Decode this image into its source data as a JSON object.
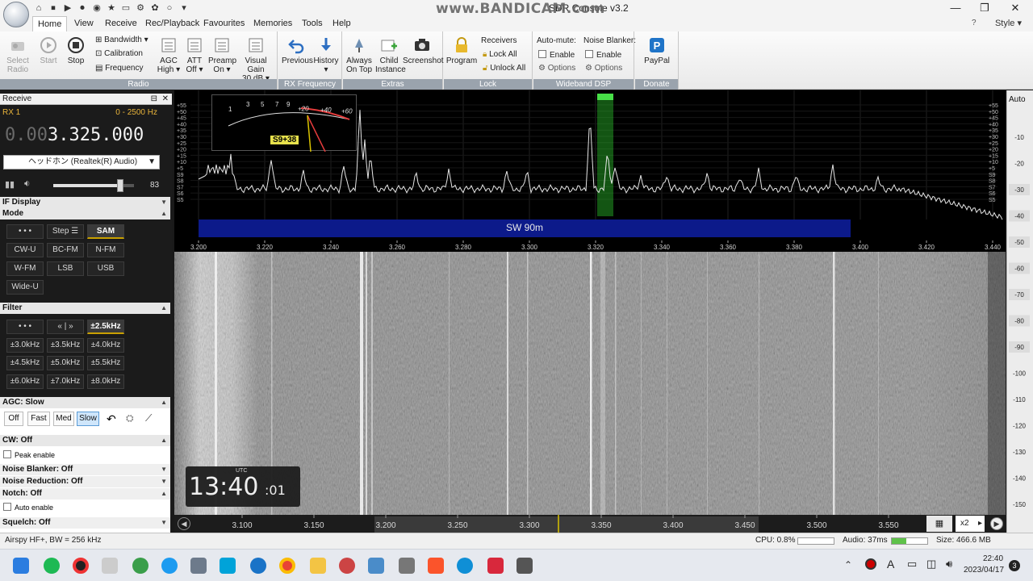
{
  "window": {
    "title": "SDR Console v3.2",
    "watermark": "www.BANDICAM.com",
    "style_label": "Style",
    "minimize": "—",
    "maximize": "❐",
    "close": "✕"
  },
  "menu": {
    "tabs": [
      "Home",
      "View",
      "Receive",
      "Rec/Playback",
      "Favourites",
      "Memories",
      "Tools",
      "Help"
    ]
  },
  "ribbon": {
    "radio": {
      "label": "Radio",
      "select_radio": "Select\nRadio",
      "start": "Start",
      "stop": "Stop",
      "bandwidth": "Bandwidth",
      "calibration": "Calibration",
      "frequency": "Frequency",
      "agc": "AGC",
      "agc_value": "High",
      "att": "ATT",
      "att_value": "Off",
      "preamp": "Preamp",
      "preamp_value": "On",
      "visual_gain": "Visual Gain",
      "visual_gain_value": "30 dB"
    },
    "rx_frequency": {
      "label": "RX Frequency",
      "previous": "Previous",
      "history": "History"
    },
    "extras": {
      "label": "Extras",
      "always_on_top_1": "Always",
      "always_on_top_2": "On Top",
      "child_1": "Child",
      "child_2": "Instance",
      "screenshot": "Screenshot"
    },
    "lock": {
      "label": "Lock",
      "program": "Program",
      "receivers": "Receivers",
      "lock_all": "Lock All",
      "unlock_all": "Unlock All"
    },
    "wideband_dsp": {
      "label": "Wideband DSP",
      "auto_mute": "Auto-mute:",
      "enable": "Enable",
      "options": "Options",
      "noise_blanker": "Noise Blanker:",
      "enable2": "Enable",
      "options2": "Options"
    },
    "donate": {
      "label": "Donate",
      "paypal": "PayPal"
    }
  },
  "left_panel": {
    "header": "Receive",
    "rx_label": "RX 1",
    "bandwidth_range": "0 - 2500 Hz",
    "freq_dim": "0.00",
    "freq_bright": "3.325.000",
    "audio_device": "ヘッドホン (Realtek(R) Audio)",
    "volume": "83",
    "volume_level": 0.83,
    "if_display": "IF Display",
    "mode_title": "Mode",
    "modes": [
      "• • •",
      "Step ☰",
      "SAM",
      "CW-U",
      "BC-FM",
      "N-FM",
      "W-FM",
      "LSB",
      "USB",
      "Wide-U"
    ],
    "selected_mode": "SAM",
    "filter_title": "Filter",
    "filters": [
      "• • •",
      "« | »",
      "±2.5kHz",
      "±3.0kHz",
      "±3.5kHz",
      "±4.0kHz",
      "±4.5kHz",
      "±5.0kHz",
      "±5.5kHz",
      "±6.0kHz",
      "±7.0kHz",
      "±8.0kHz"
    ],
    "selected_filter": "±2.5kHz",
    "agc_title": "AGC: Slow",
    "agc_buttons": [
      "Off",
      "Fast",
      "Med",
      "Slow"
    ],
    "agc_selected": "Slow",
    "cw_title": "CW: Off",
    "peak_enable": "Peak enable",
    "noise_blanker": "Noise Blanker: Off",
    "noise_reduction": "Noise Reduction: Off",
    "notch": "Notch: Off",
    "auto_enable": "Auto enable",
    "squelch": "Squelch: Off"
  },
  "spectrum": {
    "band_label": "SW 90m",
    "smeter_value": "S9+38",
    "smeter_scale": [
      "1",
      "3",
      "5",
      "7",
      "9",
      "+20",
      "+40",
      "+60"
    ],
    "db_labels_left": [
      "+55",
      "+50",
      "+45",
      "+40",
      "+35",
      "+30",
      "+25",
      "+20",
      "+15",
      "+10",
      "+5",
      "S9",
      "S8",
      "S7",
      "S6",
      "S5"
    ],
    "freq_ticks": [
      "3.200",
      "3.220",
      "3.240",
      "3.260",
      "3.280",
      "3.300",
      "3.320",
      "3.340",
      "3.360",
      "3.380",
      "3.400",
      "3.420",
      "3.440"
    ],
    "auto_label": "Auto",
    "right_db": [
      "-10",
      "-20",
      "-30",
      "-40",
      "-50",
      "-60",
      "-70",
      "-80",
      "-90",
      "-100",
      "-110",
      "-120",
      "-130",
      "-140",
      "-150"
    ]
  },
  "waterfall": {
    "clock_utc": "UTC",
    "clock_hm": "13:40",
    "clock_s": ":01",
    "bottom_ticks": [
      "3.100",
      "3.150",
      "3.200",
      "3.250",
      "3.300",
      "3.350",
      "3.400",
      "3.450",
      "3.500",
      "3.550"
    ],
    "zoom": "x2"
  },
  "statusbar": {
    "device": "Airspy HF+, BW = 256 kHz",
    "cpu": "CPU: 0.8%",
    "audio": "Audio: 37ms",
    "size": "Size: 466.6 MB"
  },
  "taskbar": {
    "time": "22:40",
    "date": "2023/04/17",
    "notification_count": "3",
    "tray_a": "A"
  }
}
